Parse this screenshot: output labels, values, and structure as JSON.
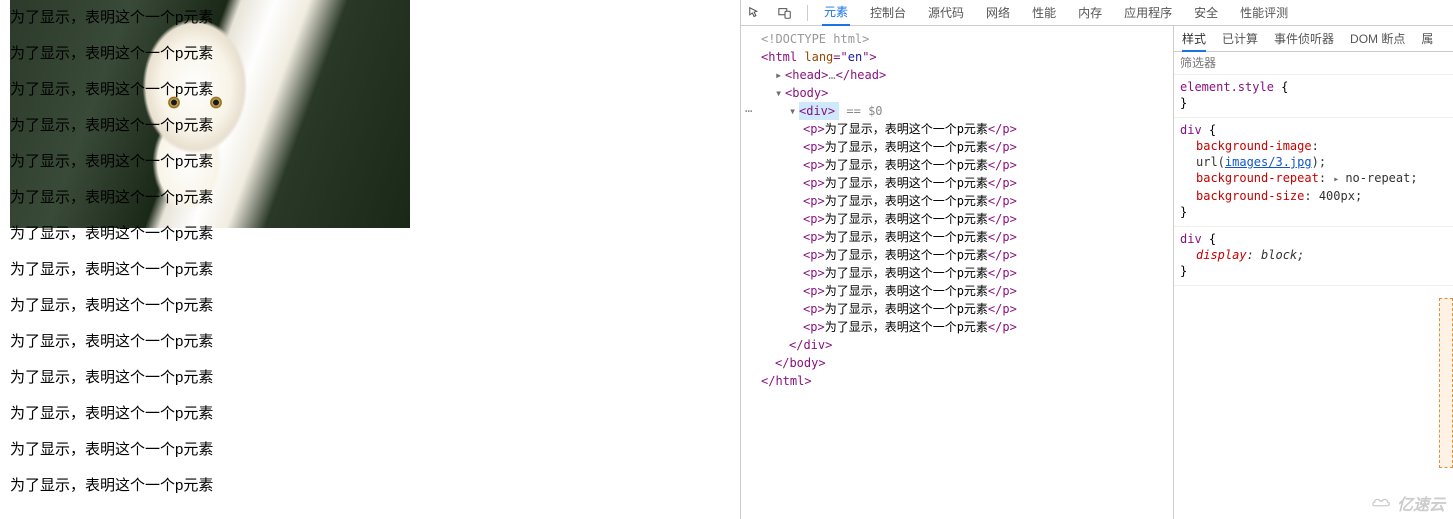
{
  "page": {
    "p_text": "为了显示，表明这个一个p元素",
    "p_count": 14
  },
  "devtools": {
    "tabs": [
      "元素",
      "控制台",
      "源代码",
      "网络",
      "性能",
      "内存",
      "应用程序",
      "安全",
      "性能评测"
    ],
    "active_tab": "元素"
  },
  "dom": {
    "doctype": "<!DOCTYPE html>",
    "html_open": "html",
    "html_lang_attr": "lang",
    "html_lang_val": "en",
    "head": "head",
    "head_ellipsis": "…",
    "body": "body",
    "div": "div",
    "selected_hint": "== $0",
    "p": "p",
    "p_text": "为了显示，表明这个一个p元素",
    "p_count": 12,
    "div_close": "/div",
    "body_close": "/body",
    "html_close": "/html"
  },
  "styles": {
    "tabs": [
      "样式",
      "已计算",
      "事件侦听器",
      "DOM 断点",
      "属"
    ],
    "active_tab": "样式",
    "filter_placeholder": "筛选器",
    "rules": [
      {
        "selector": "element.style",
        "props": []
      },
      {
        "selector": "div",
        "props": [
          {
            "name": "background-image",
            "value_prefix": "url(",
            "url": "images/3.jpg",
            "value_suffix": ");"
          },
          {
            "name": "background-repeat",
            "value": "no-repeat;",
            "expandable": true
          },
          {
            "name": "background-size",
            "value": "400px;"
          }
        ]
      },
      {
        "selector": "div",
        "ua": true,
        "props": [
          {
            "name": "display",
            "value": "block;",
            "italic": true
          }
        ]
      }
    ]
  },
  "watermark": "亿速云"
}
